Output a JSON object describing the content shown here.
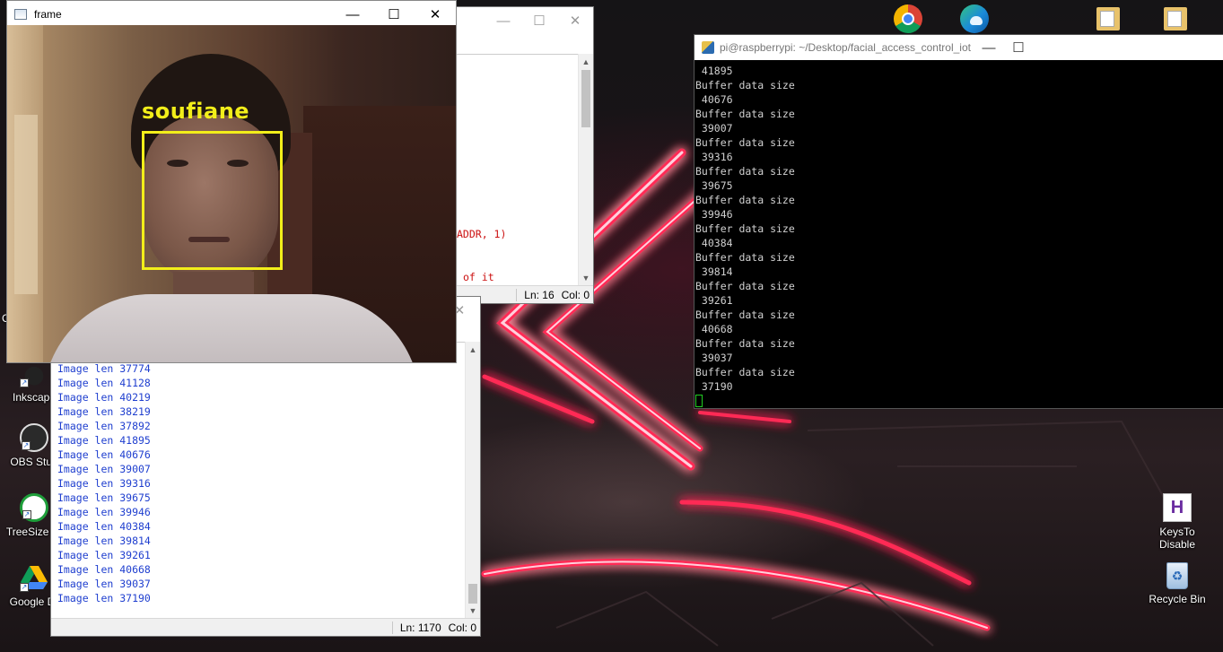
{
  "desktop": {
    "icons_left": [
      {
        "label": "Inkscape",
        "icon": "inkscape-icon"
      },
      {
        "label": "OBS Stud",
        "icon": "obs-studio-icon"
      },
      {
        "label": "TreeSize Fr",
        "icon": "treesize-icon"
      },
      {
        "label": "Google Dr",
        "icon": "google-drive-icon"
      }
    ],
    "icons_right": [
      {
        "label": "KeysTo Disable",
        "icon": "keysto-disable-icon"
      },
      {
        "label": "Recycle Bin",
        "icon": "recycle-bin-icon"
      }
    ],
    "left_edge_fragment": "C",
    "top_icons": [
      "chrome-icon",
      "edge-icon",
      "folder-icon",
      "folder-icon"
    ]
  },
  "frame_window": {
    "title": "frame",
    "face_label": "soufiane",
    "box_color": "#f2ee1a",
    "controls": {
      "minimize": "—",
      "maximize": "☐",
      "close": "✕"
    }
  },
  "editor_top": {
    "code_fragments": [
      "ADDR, 1)",
      "of it"
    ],
    "status": {
      "line": "Ln: 16",
      "col": "Col: 0"
    },
    "controls": {
      "minimize": "—",
      "maximize": "☐",
      "close": "✕"
    }
  },
  "editor_bottom": {
    "close": "✕",
    "lines": [
      "Image len 37774",
      "Image len 41128",
      "Image len 40219",
      "Image len 38219",
      "Image len 37892",
      "Image len 41895",
      "Image len 40676",
      "Image len 39007",
      "Image len 39316",
      "Image len 39675",
      "Image len 39946",
      "Image len 40384",
      "Image len 39814",
      "Image len 39261",
      "Image len 40668",
      "Image len 39037",
      "Image len 37190"
    ],
    "status": {
      "line": "Ln: 1170",
      "col": "Col: 0"
    }
  },
  "terminal": {
    "title": "pi@raspberrypi: ~/Desktop/facial_access_control_iot",
    "controls": {
      "minimize": "—",
      "maximize": "☐"
    },
    "lines": [
      " 41895",
      "Buffer data size",
      " 40676",
      "Buffer data size",
      " 39007",
      "Buffer data size",
      " 39316",
      "Buffer data size",
      " 39675",
      "Buffer data size",
      " 39946",
      "Buffer data size",
      " 40384",
      "Buffer data size",
      " 39814",
      "Buffer data size",
      " 39261",
      "Buffer data size",
      " 40668",
      "Buffer data size",
      " 39037",
      "Buffer data size",
      " 37190"
    ],
    "cursor_color": "#22cc22"
  },
  "colors": {
    "neon": "#ff2a55",
    "neon_core": "#ffd0dc",
    "editor_text": "#1f3fcf",
    "code_red": "#cc1111"
  }
}
